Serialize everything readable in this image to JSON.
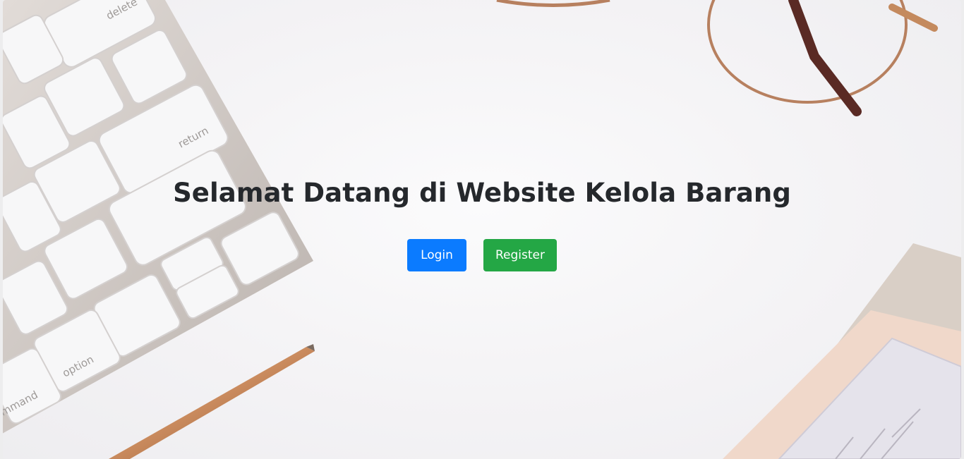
{
  "hero": {
    "title": "Selamat Datang di Website Kelola Barang",
    "login_label": "Login",
    "register_label": "Register"
  },
  "background": {
    "keyboard_keys": [
      "delete",
      "return",
      "option",
      "mmand"
    ],
    "colors": {
      "desk": "#f4f3f5",
      "keyboard_frame": "#cfc8c3",
      "key": "#f7f7f8",
      "pen": "#c98a5d",
      "glasses": "#b7805f",
      "notebook": "#dcd5cf"
    }
  },
  "colors": {
    "title": "#25282c",
    "login_button": "#0b7bff",
    "register_button": "#24a745",
    "button_text": "#ffffff"
  }
}
